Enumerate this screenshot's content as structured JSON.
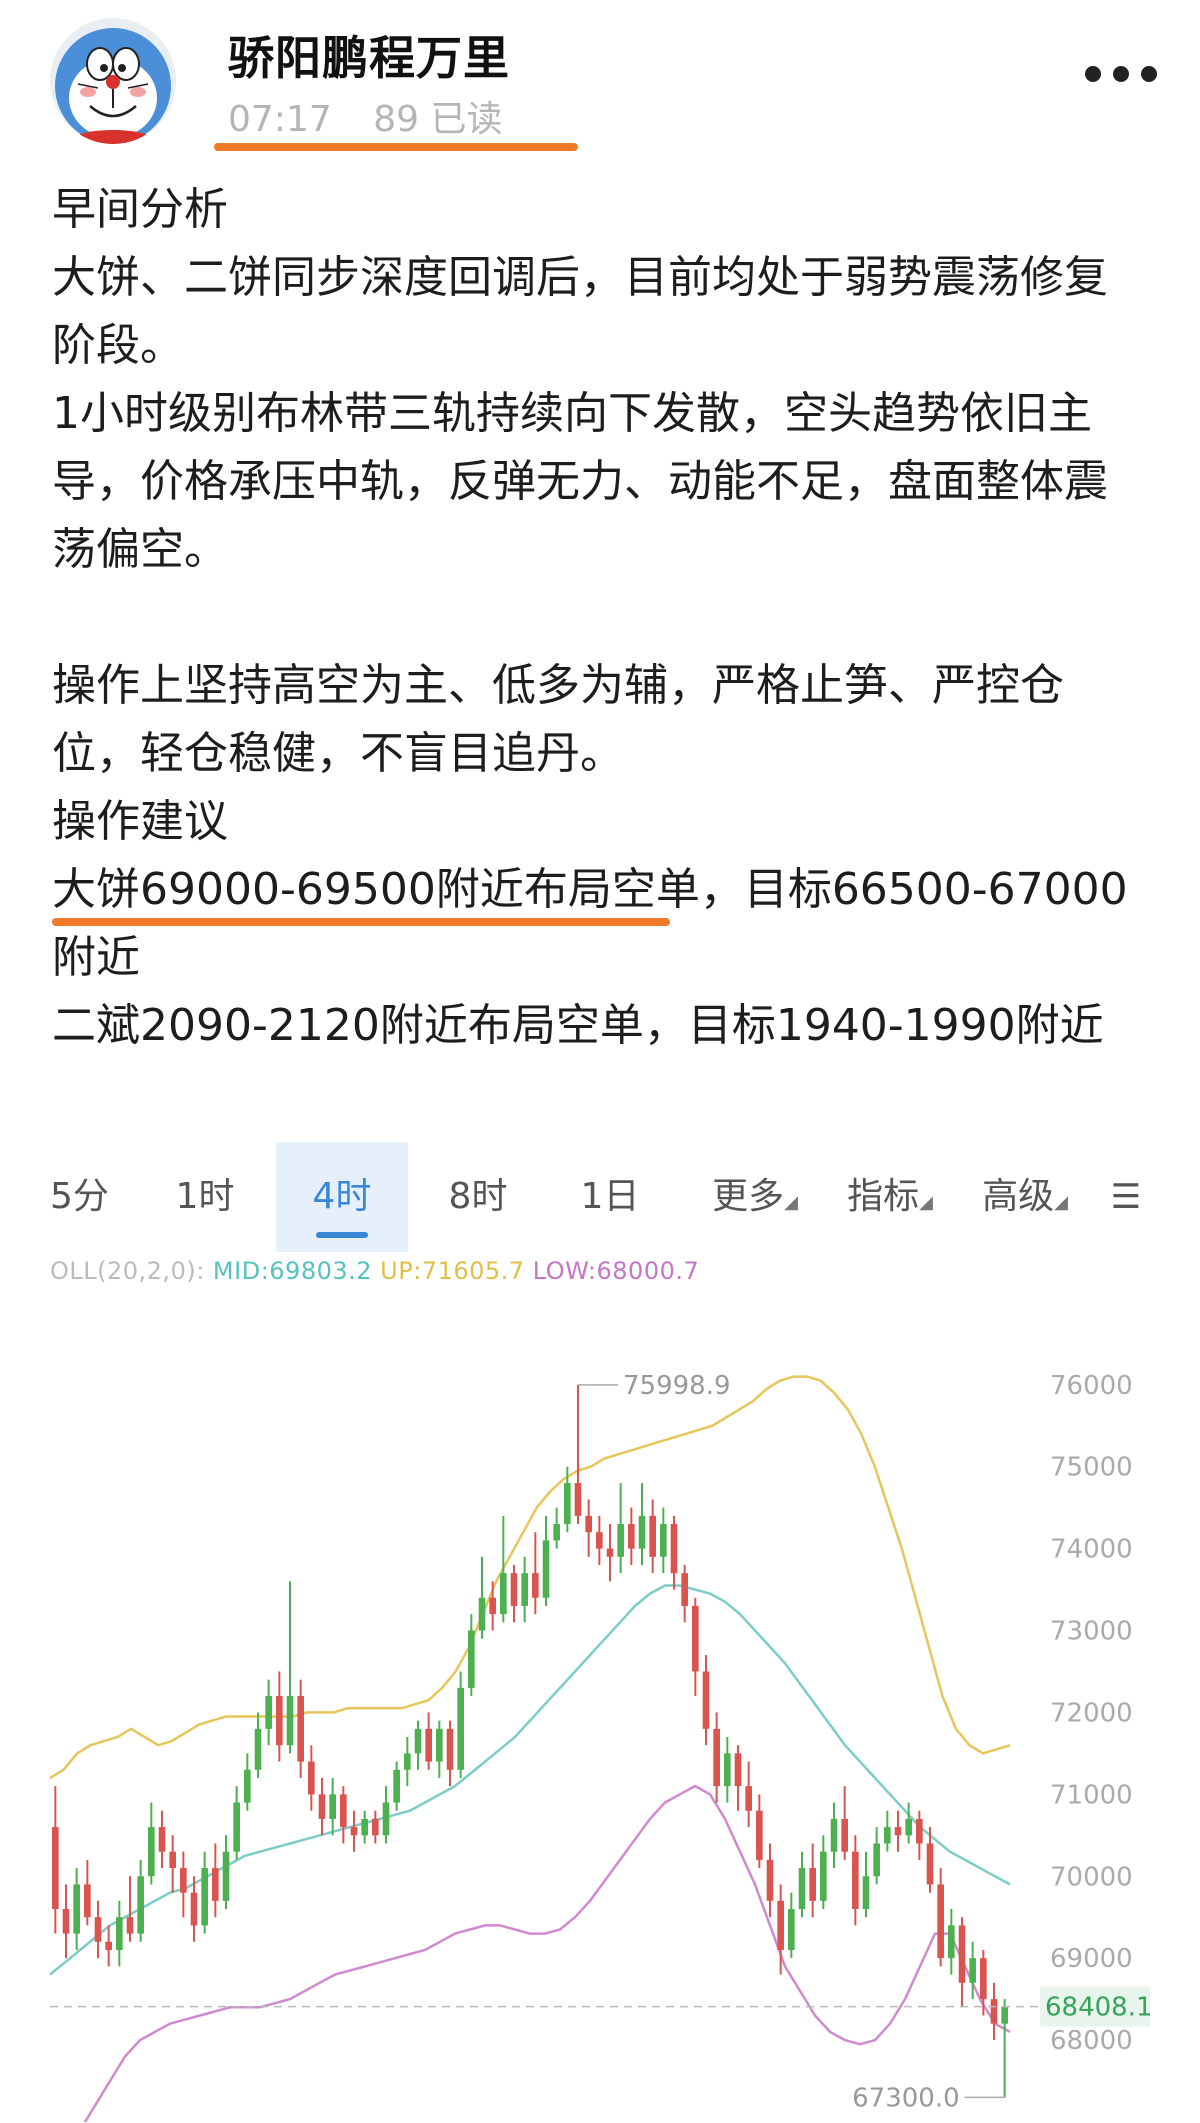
{
  "header": {
    "author": "骄阳鹏程万里",
    "time": "07:17",
    "reads": "89 已读"
  },
  "post": {
    "lines": [
      "早间分析",
      "大饼、二饼同步深度回调后，目前均处于弱势震荡修复",
      "阶段。",
      "1小时级别布林带三轨持续向下发散，空头趋势依旧主",
      "导，价格承压中轨，反弹无力、动能不足，盘面整体震",
      "荡偏空。",
      "",
      "操作上坚持高空为主、低多为辅，严格止笋、严控仓",
      "位，轻仓稳健，不盲目追丹。",
      "操作建议",
      "大饼69000-69500附近布局空单，目标66500-67000",
      "附近",
      "二斌2090-2120附近布局空单，目标1940-1990附近"
    ]
  },
  "chart": {
    "tabs": [
      "5分",
      "1时",
      "4时",
      "8时",
      "1日",
      "更多",
      "指标",
      "高级"
    ],
    "active_tab": "4时",
    "boll": {
      "prefix": "OLL(20,2,0):",
      "mid": "MID:69803.2",
      "up": "UP:71605.7",
      "low": "LOW:68000.7"
    },
    "price_labels": {
      "high": "75998.9",
      "low": "67300.0",
      "current": "68408.1"
    },
    "colors": {
      "up_candle": "#4caf50",
      "down_candle": "#d9534f",
      "upper_band": "#e6c65a",
      "mid_band": "#7ccdc8",
      "lower_band": "#cf8ad0",
      "active_tab": "#3a86d6",
      "underline": "#f07a28"
    }
  },
  "chart_data": {
    "type": "candlestick",
    "y_ticks": [
      68000,
      69000,
      70000,
      71000,
      72000,
      73000,
      74000,
      75000,
      76000
    ],
    "ylim": [
      67000,
      76400
    ],
    "current_price": 68408.1,
    "annotated_high": 75998.9,
    "annotated_low": 67300.0,
    "candles": [
      {
        "o": 70600,
        "c": 69600,
        "h": 71100,
        "l": 69300
      },
      {
        "o": 69600,
        "c": 69300,
        "h": 69900,
        "l": 69000
      },
      {
        "o": 69300,
        "c": 69900,
        "h": 70100,
        "l": 69100
      },
      {
        "o": 69900,
        "c": 69500,
        "h": 70200,
        "l": 69400
      },
      {
        "o": 69500,
        "c": 69200,
        "h": 69700,
        "l": 69000
      },
      {
        "o": 69200,
        "c": 69100,
        "h": 69400,
        "l": 68900
      },
      {
        "o": 69100,
        "c": 69500,
        "h": 69700,
        "l": 68900
      },
      {
        "o": 69500,
        "c": 69300,
        "h": 70000,
        "l": 69200
      },
      {
        "o": 69300,
        "c": 70000,
        "h": 70200,
        "l": 69200
      },
      {
        "o": 70000,
        "c": 70600,
        "h": 70900,
        "l": 69900
      },
      {
        "o": 70600,
        "c": 70300,
        "h": 70800,
        "l": 70100
      },
      {
        "o": 70300,
        "c": 70100,
        "h": 70500,
        "l": 69800
      },
      {
        "o": 70100,
        "c": 69800,
        "h": 70300,
        "l": 69500
      },
      {
        "o": 69800,
        "c": 69400,
        "h": 70000,
        "l": 69200
      },
      {
        "o": 69400,
        "c": 70100,
        "h": 70300,
        "l": 69300
      },
      {
        "o": 70100,
        "c": 69700,
        "h": 70400,
        "l": 69500
      },
      {
        "o": 69700,
        "c": 70300,
        "h": 70500,
        "l": 69600
      },
      {
        "o": 70300,
        "c": 70900,
        "h": 71100,
        "l": 70200
      },
      {
        "o": 70900,
        "c": 71300,
        "h": 71500,
        "l": 70800
      },
      {
        "o": 71300,
        "c": 71800,
        "h": 72000,
        "l": 71200
      },
      {
        "o": 71800,
        "c": 72200,
        "h": 72400,
        "l": 71600
      },
      {
        "o": 72200,
        "c": 71600,
        "h": 72500,
        "l": 71400
      },
      {
        "o": 71600,
        "c": 72200,
        "h": 73600,
        "l": 71500
      },
      {
        "o": 72200,
        "c": 71400,
        "h": 72400,
        "l": 71200
      },
      {
        "o": 71400,
        "c": 71000,
        "h": 71600,
        "l": 70800
      },
      {
        "o": 71000,
        "c": 70700,
        "h": 71200,
        "l": 70500
      },
      {
        "o": 70700,
        "c": 71000,
        "h": 71200,
        "l": 70500
      },
      {
        "o": 71000,
        "c": 70600,
        "h": 71100,
        "l": 70400
      },
      {
        "o": 70600,
        "c": 70500,
        "h": 70800,
        "l": 70300
      },
      {
        "o": 70500,
        "c": 70700,
        "h": 70800,
        "l": 70400
      },
      {
        "o": 70700,
        "c": 70500,
        "h": 70800,
        "l": 70400
      },
      {
        "o": 70500,
        "c": 70900,
        "h": 71100,
        "l": 70400
      },
      {
        "o": 70900,
        "c": 71300,
        "h": 71400,
        "l": 70800
      },
      {
        "o": 71300,
        "c": 71500,
        "h": 71700,
        "l": 71100
      },
      {
        "o": 71500,
        "c": 71800,
        "h": 71900,
        "l": 71300
      },
      {
        "o": 71800,
        "c": 71400,
        "h": 72000,
        "l": 71300
      },
      {
        "o": 71400,
        "c": 71800,
        "h": 71900,
        "l": 71200
      },
      {
        "o": 71800,
        "c": 71300,
        "h": 71900,
        "l": 71100
      },
      {
        "o": 71300,
        "c": 72300,
        "h": 72500,
        "l": 71200
      },
      {
        "o": 72300,
        "c": 73000,
        "h": 73200,
        "l": 72200
      },
      {
        "o": 73000,
        "c": 73400,
        "h": 73900,
        "l": 72900
      },
      {
        "o": 73400,
        "c": 73200,
        "h": 73600,
        "l": 73000
      },
      {
        "o": 73200,
        "c": 73700,
        "h": 74400,
        "l": 73100
      },
      {
        "o": 73700,
        "c": 73300,
        "h": 73800,
        "l": 73100
      },
      {
        "o": 73300,
        "c": 73700,
        "h": 73900,
        "l": 73100
      },
      {
        "o": 73700,
        "c": 73400,
        "h": 74200,
        "l": 73200
      },
      {
        "o": 73400,
        "c": 74100,
        "h": 74400,
        "l": 73300
      },
      {
        "o": 74100,
        "c": 74300,
        "h": 74500,
        "l": 74000
      },
      {
        "o": 74300,
        "c": 74800,
        "h": 75000,
        "l": 74200
      },
      {
        "o": 74800,
        "c": 74400,
        "h": 75999,
        "l": 74300
      },
      {
        "o": 74400,
        "c": 74200,
        "h": 74600,
        "l": 73900
      },
      {
        "o": 74200,
        "c": 74000,
        "h": 74400,
        "l": 73800
      },
      {
        "o": 74000,
        "c": 73900,
        "h": 74300,
        "l": 73600
      },
      {
        "o": 73900,
        "c": 74300,
        "h": 74800,
        "l": 73700
      },
      {
        "o": 74300,
        "c": 74000,
        "h": 74500,
        "l": 73800
      },
      {
        "o": 74000,
        "c": 74400,
        "h": 74800,
        "l": 73800
      },
      {
        "o": 74400,
        "c": 73900,
        "h": 74600,
        "l": 73700
      },
      {
        "o": 73900,
        "c": 74300,
        "h": 74500,
        "l": 73700
      },
      {
        "o": 74300,
        "c": 73700,
        "h": 74400,
        "l": 73500
      },
      {
        "o": 73700,
        "c": 73300,
        "h": 73800,
        "l": 73100
      },
      {
        "o": 73300,
        "c": 72500,
        "h": 73400,
        "l": 72200
      },
      {
        "o": 72500,
        "c": 71800,
        "h": 72700,
        "l": 71600
      },
      {
        "o": 71800,
        "c": 71100,
        "h": 72000,
        "l": 70900
      },
      {
        "o": 71100,
        "c": 71500,
        "h": 71700,
        "l": 70900
      },
      {
        "o": 71500,
        "c": 71100,
        "h": 71600,
        "l": 70800
      },
      {
        "o": 71100,
        "c": 70800,
        "h": 71400,
        "l": 70600
      },
      {
        "o": 70800,
        "c": 70200,
        "h": 71000,
        "l": 70100
      },
      {
        "o": 70200,
        "c": 69700,
        "h": 70400,
        "l": 69500
      },
      {
        "o": 69700,
        "c": 69100,
        "h": 69900,
        "l": 68800
      },
      {
        "o": 69100,
        "c": 69600,
        "h": 69800,
        "l": 69000
      },
      {
        "o": 69600,
        "c": 70100,
        "h": 70300,
        "l": 69500
      },
      {
        "o": 70100,
        "c": 69700,
        "h": 70400,
        "l": 69500
      },
      {
        "o": 69700,
        "c": 70300,
        "h": 70500,
        "l": 69600
      },
      {
        "o": 70300,
        "c": 70700,
        "h": 70900,
        "l": 70100
      },
      {
        "o": 70700,
        "c": 70300,
        "h": 71100,
        "l": 70200
      },
      {
        "o": 70300,
        "c": 69600,
        "h": 70500,
        "l": 69400
      },
      {
        "o": 69600,
        "c": 70000,
        "h": 70300,
        "l": 69500
      },
      {
        "o": 70000,
        "c": 70400,
        "h": 70600,
        "l": 69900
      },
      {
        "o": 70400,
        "c": 70600,
        "h": 70800,
        "l": 70300
      },
      {
        "o": 70600,
        "c": 70500,
        "h": 70800,
        "l": 70300
      },
      {
        "o": 70500,
        "c": 70700,
        "h": 70900,
        "l": 70400
      },
      {
        "o": 70700,
        "c": 70400,
        "h": 70800,
        "l": 70200
      },
      {
        "o": 70400,
        "c": 69900,
        "h": 70600,
        "l": 69800
      },
      {
        "o": 69900,
        "c": 69000,
        "h": 70100,
        "l": 68900
      },
      {
        "o": 69000,
        "c": 69400,
        "h": 69600,
        "l": 68800
      },
      {
        "o": 69400,
        "c": 68700,
        "h": 69500,
        "l": 68400
      },
      {
        "o": 68700,
        "c": 69000,
        "h": 69200,
        "l": 68500
      },
      {
        "o": 69000,
        "c": 68500,
        "h": 69100,
        "l": 68300
      },
      {
        "o": 68500,
        "c": 68200,
        "h": 68700,
        "l": 68000
      },
      {
        "o": 68200,
        "c": 68408,
        "h": 68500,
        "l": 67300
      }
    ],
    "upper_band": [
      71200,
      71300,
      71500,
      71600,
      71650,
      71700,
      71800,
      71700,
      71600,
      71650,
      71750,
      71850,
      71900,
      71950,
      71950,
      71950,
      71950,
      71950,
      71950,
      72000,
      72000,
      72000,
      72050,
      72050,
      72050,
      72050,
      72050,
      72100,
      72150,
      72300,
      72500,
      72800,
      73200,
      73600,
      73900,
      74200,
      74500,
      74700,
      74850,
      74950,
      75000,
      75100,
      75150,
      75200,
      75250,
      75300,
      75350,
      75400,
      75450,
      75500,
      75600,
      75700,
      75800,
      75950,
      76050,
      76100,
      76100,
      76050,
      75900,
      75700,
      75400,
      75000,
      74500,
      74000,
      73400,
      72800,
      72200,
      71800,
      71600,
      71500,
      71550,
      71600
    ],
    "mid_band": [
      68800,
      68950,
      69100,
      69250,
      69400,
      69500,
      69600,
      69700,
      69800,
      69850,
      69950,
      70050,
      70150,
      70250,
      70300,
      70350,
      70400,
      70450,
      70500,
      70550,
      70600,
      70650,
      70700,
      70750,
      70800,
      70900,
      71000,
      71100,
      71250,
      71400,
      71550,
      71700,
      71900,
      72100,
      72300,
      72500,
      72700,
      72900,
      73100,
      73300,
      73450,
      73550,
      73550,
      73500,
      73450,
      73350,
      73200,
      73000,
      72800,
      72600,
      72350,
      72100,
      71850,
      71600,
      71400,
      71200,
      71000,
      70800,
      70600,
      70450,
      70300,
      70200,
      70100,
      70000,
      69900
    ],
    "lower_band": [
      66200,
      66600,
      66900,
      67200,
      67500,
      67800,
      68000,
      68100,
      68200,
      68250,
      68300,
      68350,
      68400,
      68400,
      68400,
      68450,
      68500,
      68600,
      68700,
      68800,
      68850,
      68900,
      68950,
      69000,
      69050,
      69100,
      69200,
      69300,
      69350,
      69400,
      69400,
      69350,
      69300,
      69300,
      69350,
      69500,
      69700,
      69950,
      70200,
      70450,
      70700,
      70900,
      71000,
      71100,
      71000,
      70700,
      70300,
      69900,
      69400,
      68900,
      68600,
      68300,
      68100,
      68000,
      67950,
      68000,
      68200,
      68500,
      68900,
      69300,
      69300,
      68900,
      68500,
      68200,
      68100
    ]
  }
}
